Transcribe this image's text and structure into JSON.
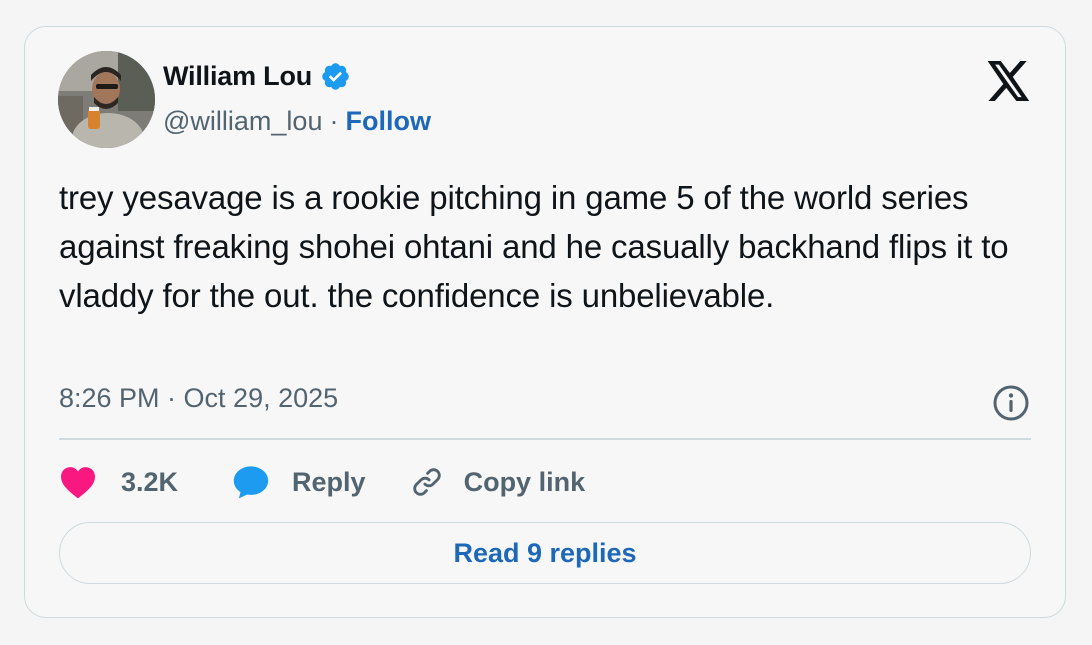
{
  "author": {
    "name": "William Lou",
    "handle": "@william_lou",
    "separator": "·",
    "follow_label": "Follow",
    "verified": true
  },
  "tweet": {
    "text": "trey yesavage is a rookie pitching in game 5 of the world series against freaking shohei ohtani and he casually backhand flips it to vladdy for the out. the confidence is unbelievable.",
    "timestamp": "8:26 PM · Oct 29, 2025"
  },
  "actions": {
    "likes": "3.2K",
    "reply_label": "Reply",
    "copy_link_label": "Copy link"
  },
  "read_replies_label": "Read 9 replies",
  "icons": {
    "brand": "x-logo-icon",
    "verified": "verified-badge-icon",
    "info": "info-icon",
    "like": "heart-icon",
    "reply": "speech-bubble-icon",
    "copy": "link-icon"
  },
  "colors": {
    "link_blue": "#1d68b8",
    "verified_blue": "#1d9bf0",
    "heart_pink": "#f91880",
    "reply_blue": "#1d9bf0",
    "secondary_text": "#536471",
    "border": "#cfd9de"
  }
}
